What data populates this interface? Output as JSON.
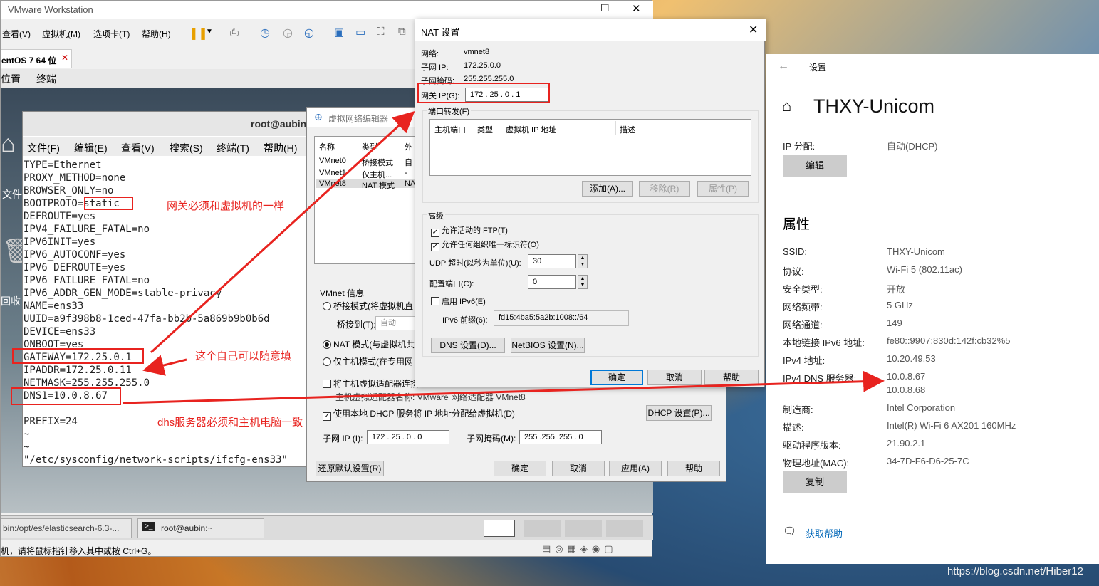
{
  "vmware": {
    "title": "VMware Workstation",
    "menu": [
      "查看(V)",
      "虚拟机(M)",
      "选项卡(T)",
      "帮助(H)"
    ],
    "tab": "entOS 7 64 位",
    "submenu": [
      "位置",
      "终端"
    ],
    "desktop_labels": [
      "文件",
      "回收"
    ],
    "taskbar": [
      "bin:/opt/es/elasticsearch-6.3-...",
      "root@aubin:~"
    ],
    "status": "机，请将鼠标指针移入其中或按 Ctrl+G。"
  },
  "terminal": {
    "title": "root@aubin",
    "menu": [
      "文件(F)",
      "编辑(E)",
      "查看(V)",
      "搜索(S)",
      "终端(T)",
      "帮助(H)"
    ],
    "lines": [
      "TYPE=Ethernet",
      "PROXY_METHOD=none",
      "BROWSER_ONLY=no",
      "BOOTPROTO=static",
      "DEFROUTE=yes",
      "IPV4_FAILURE_FATAL=no",
      "IPV6INIT=yes",
      "IPV6_AUTOCONF=yes",
      "IPV6_DEFROUTE=yes",
      "IPV6_FAILURE_FATAL=no",
      "IPV6_ADDR_GEN_MODE=stable-privacy",
      "NAME=ens33",
      "UUID=a9f398b8-1ced-47fa-bb2b-5a869b9b0b6d",
      "DEVICE=ens33",
      "ONBOOT=yes",
      "GATEWAY=172.25.0.1",
      "IPADDR=172.25.0.11",
      "NETMASK=255.255.255.0",
      "DNS1=10.0.8.67",
      "",
      "PREFIX=24",
      "~",
      "~",
      "\"/etc/sysconfig/network-scripts/ifcfg-ens33\""
    ]
  },
  "annotations": {
    "gateway_note": "网关必须和虚拟机的一样",
    "ip_note": "这个自己可以随意填",
    "dns_note": "dhs服务器必须和主机电脑一致"
  },
  "vnet_editor": {
    "title": "虚拟网络编辑器",
    "cols": [
      "名称",
      "类型",
      "外"
    ],
    "rows": [
      [
        "VMnet0",
        "桥接模式",
        "自"
      ],
      [
        "VMnet1",
        "仅主机...",
        "-"
      ],
      [
        "VMnet8",
        "NAT 模式",
        "NA"
      ]
    ],
    "info_label": "VMnet 信息",
    "bridge_mode": "桥接模式(将虚拟机直",
    "bridge_to": "桥接到(T):",
    "bridge_auto": "自动",
    "nat_mode": "NAT 模式(与虚拟机共",
    "host_only": "仅主机模式(在专用网",
    "connect_adapter": "将主机虚拟适配器连接",
    "adapter_name": "主机虚拟适配器名称: VMware 网络适配器 VMnet8",
    "dhcp_check": "使用本地 DHCP 服务将 IP 地址分配给虚拟机(D)",
    "dhcp_btn": "DHCP 设置(P)...",
    "subnet_ip_label": "子网 IP (I):",
    "subnet_ip": "172 . 25 . 0 . 0",
    "mask_label": "子网掩码(M):",
    "mask": "255 .255 .255 . 0",
    "restore": "还原默认设置(R)",
    "ok": "确定",
    "cancel": "取消",
    "apply": "应用(A)",
    "help": "帮助"
  },
  "nat": {
    "title": "NAT 设置",
    "net_label": "网络:",
    "net": "vmnet8",
    "subnet_label": "子网 IP:",
    "subnet": "172.25.0.0",
    "mask_label": "子网掩码:",
    "mask": "255.255.255.0",
    "gw_label": "网关 IP(G):",
    "gw": "172 . 25 . 0 . 1",
    "pf_label": "端口转发(F)",
    "pf_cols": [
      "主机端口",
      "类型",
      "虚拟机 IP 地址",
      "描述"
    ],
    "add": "添加(A)...",
    "remove": "移除(R)",
    "props": "属性(P)",
    "adv_label": "高级",
    "ftp": "允许活动的 FTP(T)",
    "uid": "允许任何组织唯一标识符(O)",
    "udp_label": "UDP 超时(以秒为单位)(U):",
    "udp": "30",
    "cfg_label": "配置端口(C):",
    "cfg": "0",
    "ipv6": "启用 IPv6(E)",
    "ipv6_prefix_label": "IPv6 前缀(6):",
    "ipv6_prefix": "fd15:4ba5:5a2b:1008::/64",
    "dns_btn": "DNS 设置(D)...",
    "netbios_btn": "NetBIOS 设置(N)...",
    "ok": "确定",
    "cancel": "取消",
    "help": "帮助"
  },
  "settings": {
    "title": "设置",
    "network": "THXY-Unicom",
    "ip_assign_label": "IP 分配:",
    "ip_assign": "自动(DHCP)",
    "edit": "编辑",
    "props_title": "属性",
    "props": [
      [
        "SSID:",
        "THXY-Unicom"
      ],
      [
        "协议:",
        "Wi-Fi 5 (802.11ac)"
      ],
      [
        "安全类型:",
        "开放"
      ],
      [
        "网络频带:",
        "5 GHz"
      ],
      [
        "网络通道:",
        "149"
      ],
      [
        "本地链接 IPv6 地址:",
        "fe80::9907:830d:142f:cb32%5"
      ],
      [
        "IPv4 地址:",
        "10.20.49.53"
      ],
      [
        "IPv4 DNS 服务器:",
        "10.0.8.67"
      ],
      [
        "",
        "10.0.8.68"
      ],
      [
        "制造商:",
        "Intel Corporation"
      ],
      [
        "描述:",
        "Intel(R) Wi-Fi 6 AX201 160MHz"
      ],
      [
        "驱动程序版本:",
        "21.90.2.1"
      ],
      [
        "物理地址(MAC):",
        "34-7D-F6-D6-25-7C"
      ]
    ],
    "copy": "复制",
    "help": "获取帮助"
  },
  "watermark": "https://blog.csdn.net/Hiber12"
}
